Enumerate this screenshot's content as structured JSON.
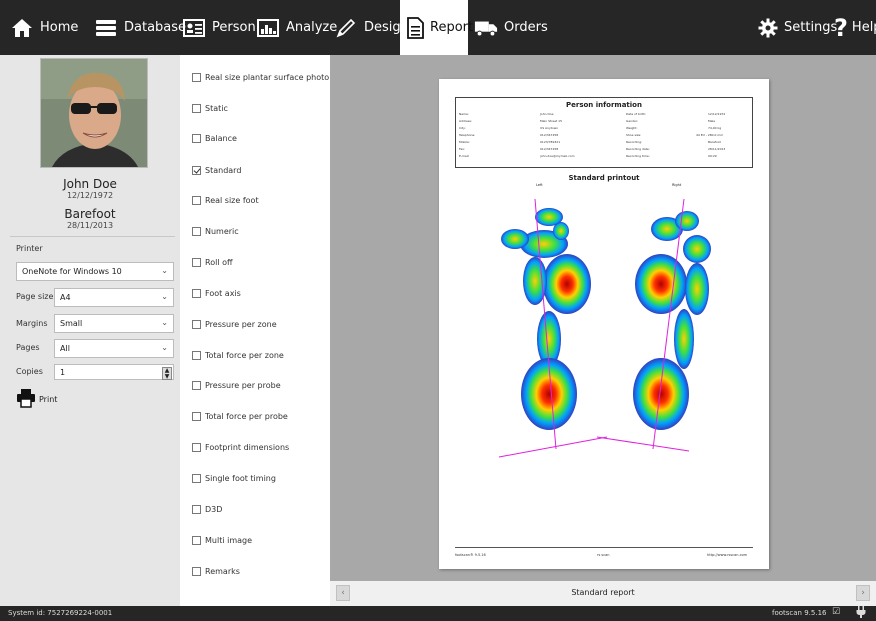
{
  "nav": {
    "home": "Home",
    "database": "Database",
    "person": "Person",
    "analyze": "Analyze",
    "design": "Design",
    "report": "Report",
    "orders": "Orders",
    "settings": "Settings",
    "help": "Help"
  },
  "patient": {
    "name": "John Doe",
    "dob": "12/12/1972",
    "condition": "Barefoot",
    "recording_date": "28/11/2013"
  },
  "print": {
    "printer_label": "Printer",
    "printer_value": "OneNote for Windows 10",
    "page_size_label": "Page size",
    "page_size_value": "A4",
    "margins_label": "Margins",
    "margins_value": "Small",
    "pages_label": "Pages",
    "pages_value": "All",
    "copies_label": "Copies",
    "copies_value": "1",
    "print_button": "Print"
  },
  "checklist": [
    {
      "label": "Real size plantar surface photo",
      "checked": false
    },
    {
      "label": "Static",
      "checked": false
    },
    {
      "label": "Balance",
      "checked": false
    },
    {
      "label": "Standard",
      "checked": true
    },
    {
      "label": "Real size foot",
      "checked": false
    },
    {
      "label": "Numeric",
      "checked": false
    },
    {
      "label": "Roll off",
      "checked": false
    },
    {
      "label": "Foot axis",
      "checked": false
    },
    {
      "label": "Pressure per zone",
      "checked": false
    },
    {
      "label": "Total force per zone",
      "checked": false
    },
    {
      "label": "Pressure per probe",
      "checked": false
    },
    {
      "label": "Total force per probe",
      "checked": false
    },
    {
      "label": "Footprint dimensions",
      "checked": false
    },
    {
      "label": "Single foot timing",
      "checked": false
    },
    {
      "label": "D3D",
      "checked": false
    },
    {
      "label": "Multi image",
      "checked": false
    },
    {
      "label": "Remarks",
      "checked": false
    }
  ],
  "report": {
    "info_title": "Person information",
    "left_rows": [
      {
        "k": "Name:",
        "v": "John Doe"
      },
      {
        "k": "Address:",
        "v": "Main Street 15"
      },
      {
        "k": "City:",
        "v": "US Anytown"
      },
      {
        "k": "Telephone:",
        "v": "012/347258"
      },
      {
        "k": "Mobile:",
        "v": "0123/789321"
      },
      {
        "k": "Fax:",
        "v": "012/347258"
      },
      {
        "k": "E-mail:",
        "v": "john.doe@mymail.com"
      }
    ],
    "right_rows": [
      {
        "k": "Date of birth:",
        "v": "12/12/1972"
      },
      {
        "k": "Gender:",
        "v": "Male"
      },
      {
        "k": "Weight:",
        "v": "74,00 kg"
      },
      {
        "k": "Shoe size:",
        "v": "44 EU - 280.0 mm"
      },
      {
        "k": "Recording:",
        "v": "Barefoot"
      },
      {
        "k": "Recording date:",
        "v": "28/11/2013"
      },
      {
        "k": "Recording time:",
        "v": "09:29"
      }
    ],
    "printout_title": "Standard printout",
    "left_label": "Left",
    "right_label": "Right",
    "footer_left": "footscan® 9.5.16",
    "footer_mid": "rs scan",
    "footer_right": "http://www.rsscan.com"
  },
  "preview_caption": "Standard report",
  "status": {
    "system_id": "System id: 7527269224-0001",
    "version": "footscan 9.5.16"
  },
  "colors": {
    "topbar": "#262626",
    "left_panel": "#e6e6e6",
    "preview_bg": "#a8a8a8",
    "axis_line": "#e020e0"
  },
  "icons": [
    "home-icon",
    "database-icon",
    "person-card-icon",
    "analyze-icon",
    "design-pencil-icon",
    "report-document-icon",
    "orders-truck-icon",
    "settings-gear-icon",
    "help-question-icon",
    "printer-icon",
    "check-icon",
    "plug-icon"
  ]
}
